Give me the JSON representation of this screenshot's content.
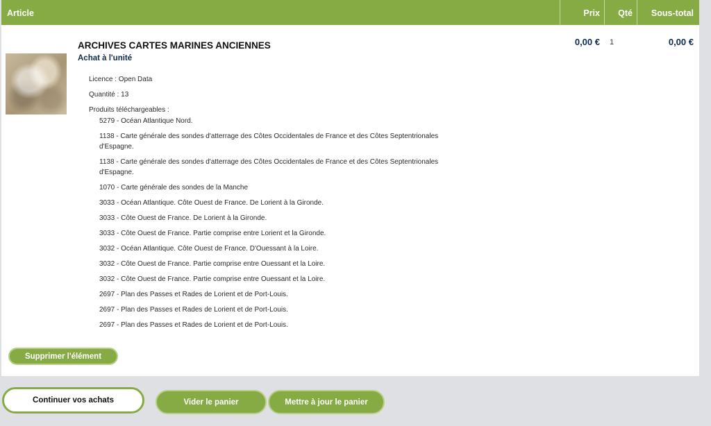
{
  "table_header": {
    "article": "Article",
    "prix": "Prix",
    "qte": "Qté",
    "sous_total": "Sous-total"
  },
  "item": {
    "title": "ARCHIVES CARTES MARINES ANCIENNES",
    "subtitle": "Achat à l'unité",
    "licence": "Licence : Open Data",
    "quantite": "Quantité : 13",
    "produits_label": "Produits téléchargeables :",
    "products": [
      "5279 - Océan Atlantique Nord.",
      "1138 - Carte générale des sondes d'atterrage des Côtes Occidentales de France et des Côtes Septentrionales d'Espagne.",
      "1138 - Carte générale des sondes d'atterrage des Côtes Occidentales de France et des Côtes Septentrionales d'Espagne.",
      "1070 - Carte générale des sondes de la Manche",
      "3033 - Océan Atlantique. Côte Ouest de France. De Lorient à la Gironde.",
      "3033 - Côte Ouest de France. De Lorient à la Gironde.",
      "3033 - Côte Ouest de France. Partie comprise entre Lorient et la Gironde.",
      "3032 - Océan Atlantique. Côte Ouest de France. D'Ouessant à la Loire.",
      "3032 - Côte Ouest de France. Partie comprise entre Ouessant et la Loire.",
      "3032 - Côte Ouest de France. Partie comprise entre Ouessant et la Loire.",
      "2697 - Plan des Passes et Rades de Lorient et de Port-Louis.",
      "2697 - Plan des Passes et Rades de Lorient et de Port-Louis.",
      "2697 - Plan des Passes et Rades de Lorient et de Port-Louis."
    ],
    "prix": "0,00 €",
    "qte": "1",
    "sous_total": "0,00 €"
  },
  "buttons": {
    "delete": "Supprimer l'élément",
    "continue": "Continuer vos achats",
    "empty": "Vider le panier",
    "update": "Mettre à jour le panier"
  },
  "colors": {
    "accent": "#86ab45",
    "navy": "#0e2a4d",
    "background": "#dfe0e4"
  }
}
